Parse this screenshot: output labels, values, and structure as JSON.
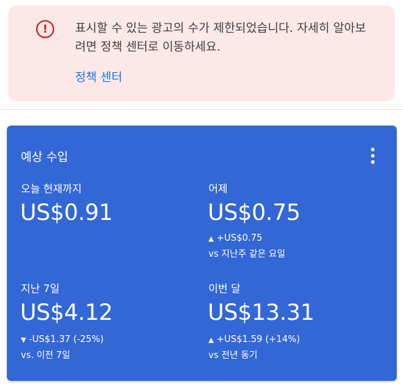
{
  "alert": {
    "message": "표시할 수 있는 광고의 수가 제한되었습니다. 자세히 알아보려면 정책 센터로 이동하세요.",
    "link_label": "정책 센터",
    "icon": "exclamation-circle-icon",
    "icon_glyph": "!",
    "color": "#c5221f",
    "background": "#fce8e6"
  },
  "card": {
    "title": "예상 수입",
    "menu_icon": "more-vertical-icon",
    "background": "#3367d6",
    "metrics": [
      {
        "label": "오늘 현재까지",
        "value": "US$0.91"
      },
      {
        "label": "어제",
        "value": "US$0.75",
        "direction_glyph": "▲",
        "change": "+US$0.75",
        "compare": "vs 지난주 같은 요일"
      },
      {
        "label": "지난 7일",
        "value": "US$4.12",
        "direction_glyph": "▼",
        "change": "-US$1.37 (-25%)",
        "compare": "vs. 이전 7일"
      },
      {
        "label": "이번 달",
        "value": "US$13.31",
        "direction_glyph": "▲",
        "change": "+US$1.59 (+14%)",
        "compare": "vs 전년 동기"
      }
    ]
  }
}
